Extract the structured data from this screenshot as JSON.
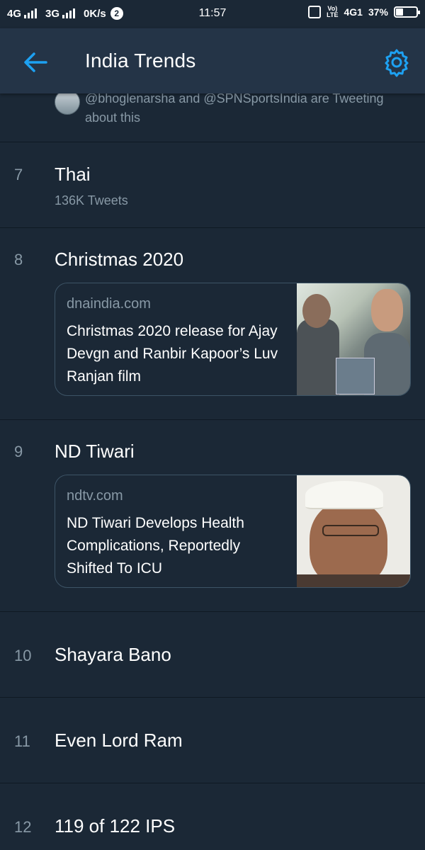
{
  "status_bar": {
    "network_1": "4G",
    "network_2": "3G",
    "speed": "0K/s",
    "notification_count": "2",
    "time": "11:57",
    "volte_top": "Vo)",
    "volte_bottom": "LTE",
    "network_3": "4G1",
    "battery_percent": "37%",
    "battery_level": 0.37
  },
  "header": {
    "title": "India Trends",
    "accent_color": "#1da1f2"
  },
  "partial_item": {
    "context_text": "@bhoglenarsha and @SPNSportsIndia are Tweeting about this"
  },
  "trends": [
    {
      "rank": "7",
      "name": "Thai",
      "tweets": "136K Tweets"
    },
    {
      "rank": "8",
      "name": "Christmas 2020",
      "card": {
        "domain": "dnaindia.com",
        "headline": "Christmas 2020 release for Ajay Devgn and Ranbir Kapoor’s Luv Ranjan film"
      }
    },
    {
      "rank": "9",
      "name": "ND Tiwari",
      "card": {
        "domain": "ndtv.com",
        "headline": "ND Tiwari Develops Health Complications, Reportedly Shifted To ICU"
      }
    },
    {
      "rank": "10",
      "name": "Shayara Bano"
    },
    {
      "rank": "11",
      "name": "Even Lord Ram"
    },
    {
      "rank": "12",
      "name": "119 of 122 IPS"
    }
  ]
}
